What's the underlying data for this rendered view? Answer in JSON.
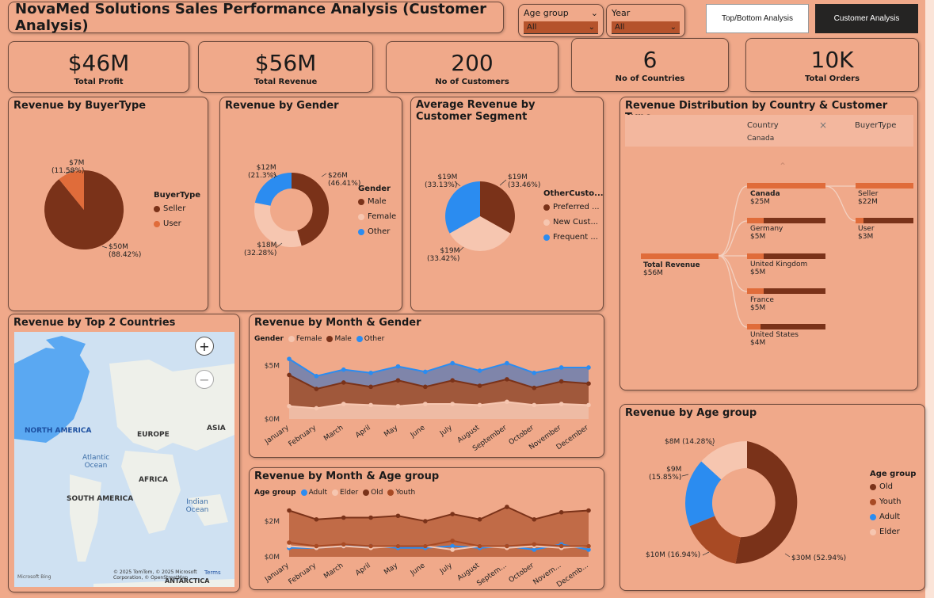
{
  "header": {
    "title": "NovaMed Solutions Sales Performance Analysis (Customer Analysis)"
  },
  "slicers": {
    "age_group": {
      "label": "Age group",
      "value": "All"
    },
    "year": {
      "label": "Year",
      "value": "All"
    }
  },
  "nav": {
    "topbottom": "Top/Bottom Analysis",
    "customer": "Customer Analysis"
  },
  "kpis": [
    {
      "value": "$46M",
      "label": "Total Profit"
    },
    {
      "value": "$56M",
      "label": "Total Revenue"
    },
    {
      "value": "200",
      "label": "No of Customers"
    },
    {
      "value": "6",
      "label": "No of Countries"
    },
    {
      "value": "10K",
      "label": "Total Orders"
    }
  ],
  "colors": {
    "bg": "#f0a98a",
    "seller": "#7a3219",
    "user": "#e06c3a",
    "female": "#f6c6b0",
    "male": "#7a3219",
    "other": "#2b8cf0",
    "adult": "#2b8cf0",
    "youth": "#a84a24",
    "old": "#7a3219",
    "elder": "#f6c6b0"
  },
  "buyer": {
    "title": "Revenue by BuyerType",
    "legend_title": "BuyerType",
    "items": [
      "Seller",
      "User"
    ],
    "label_user": [
      "$7M",
      "(11.58%)"
    ],
    "label_seller": [
      "$50M",
      "(88.42%)"
    ]
  },
  "gender": {
    "title": "Revenue by Gender",
    "legend_title": "Gender",
    "items": [
      "Male",
      "Female",
      "Other"
    ],
    "label_other": [
      "$12M",
      "(21.3%)"
    ],
    "label_male": [
      "$26M",
      "(46.41%)"
    ],
    "label_female": [
      "$18M",
      "(32.28%)"
    ]
  },
  "segment": {
    "title": "Average Revenue by Customer Segment",
    "legend_title": "OtherCusto...",
    "items": [
      "Preferred ...",
      "New Cust...",
      "Frequent ..."
    ],
    "label_a": [
      "$19M",
      "(33.13%)"
    ],
    "label_b": [
      "$19M",
      "(33.46%)"
    ],
    "label_c": [
      "$19M",
      "(33.42%)"
    ]
  },
  "decomp": {
    "title": "Revenue Distribution by Country & Customer Type",
    "col1": "Country",
    "col1_sub": "Canada",
    "col2": "BuyerType",
    "root": {
      "label": "Total Revenue",
      "value": "$56M"
    },
    "countries": [
      {
        "name": "Canada",
        "value": "$25M"
      },
      {
        "name": "Germany",
        "value": "$5M"
      },
      {
        "name": "United Kingdom",
        "value": "$5M"
      },
      {
        "name": "France",
        "value": "$5M"
      },
      {
        "name": "United States",
        "value": "$4M"
      }
    ],
    "buyers": [
      {
        "name": "Seller",
        "value": "$22M"
      },
      {
        "name": "User",
        "value": "$3M"
      }
    ]
  },
  "map": {
    "title": "Revenue by Top 2 Countries",
    "labels": [
      "NORTH AMERICA",
      "EUROPE",
      "ASIA",
      "AFRICA",
      "SOUTH AMERICA",
      "Atlantic Ocean",
      "Indian Ocean",
      "ANTARCTICA"
    ],
    "attribution": "© 2025 TomTom, © 2025 Microsoft Corporation, © OpenStreetMap",
    "terms": "Terms",
    "brand": "Microsoft Bing"
  },
  "month_gender": {
    "title": "Revenue by Month & Gender",
    "legend_title": "Gender",
    "legend": [
      "Female",
      "Male",
      "Other"
    ]
  },
  "month_age": {
    "title": "Revenue by Month & Age group",
    "legend_title": "Age group",
    "legend": [
      "Adult",
      "Elder",
      "Old",
      "Youth"
    ]
  },
  "age": {
    "title": "Revenue by Age group",
    "legend_title": "Age group",
    "items": [
      "Old",
      "Youth",
      "Adult",
      "Elder"
    ],
    "label_elder": "$8M (14.28%)",
    "label_adult": [
      "$9M",
      "(15.85%)"
    ],
    "label_youth": "$10M (16.94%)",
    "label_old": "$30M (52.94%)"
  },
  "chart_data": [
    {
      "type": "pie",
      "title": "Revenue by BuyerType",
      "categories": [
        "Seller",
        "User"
      ],
      "values": [
        50,
        7
      ],
      "percent": [
        88.42,
        11.58
      ]
    },
    {
      "type": "pie",
      "title": "Revenue by Gender",
      "categories": [
        "Male",
        "Female",
        "Other"
      ],
      "values": [
        26,
        18,
        12
      ],
      "percent": [
        46.41,
        32.28,
        21.3
      ]
    },
    {
      "type": "pie",
      "title": "Average Revenue by Customer Segment",
      "categories": [
        "Preferred ...",
        "New Cust...",
        "Frequent ..."
      ],
      "values": [
        19,
        19,
        19
      ],
      "percent": [
        33.46,
        33.42,
        33.13
      ]
    },
    {
      "type": "pie",
      "title": "Revenue by Age group",
      "categories": [
        "Old",
        "Youth",
        "Adult",
        "Elder"
      ],
      "values": [
        30,
        10,
        9,
        8
      ],
      "percent": [
        52.94,
        16.94,
        15.85,
        14.28
      ]
    },
    {
      "type": "area",
      "title": "Revenue by Month & Gender",
      "categories": [
        "January",
        "February",
        "March",
        "April",
        "May",
        "June",
        "July",
        "August",
        "September",
        "October",
        "November",
        "December"
      ],
      "yticks": [
        "$5M",
        "$0M"
      ],
      "ylim": [
        0,
        6.2
      ],
      "series": [
        {
          "name": "Female",
          "values": [
            1.2,
            1.0,
            1.4,
            1.3,
            1.2,
            1.4,
            1.4,
            1.3,
            1.6,
            1.3,
            1.4,
            1.3
          ]
        },
        {
          "name": "Male",
          "values": [
            4.1,
            2.8,
            3.4,
            3.0,
            3.6,
            3.0,
            3.6,
            3.1,
            3.7,
            2.9,
            3.5,
            3.3
          ]
        },
        {
          "name": "Other",
          "values": [
            5.6,
            4.0,
            4.6,
            4.3,
            4.9,
            4.4,
            5.2,
            4.5,
            5.2,
            4.3,
            4.8,
            4.8
          ]
        }
      ]
    },
    {
      "type": "area",
      "title": "Revenue by Month & Age group",
      "categories": [
        "January",
        "February",
        "March",
        "April",
        "May",
        "June",
        "July",
        "August",
        "Septem...",
        "October",
        "Novem...",
        "Decemb..."
      ],
      "yticks": [
        "$2M",
        "$0M"
      ],
      "ylim": [
        0,
        3.2
      ],
      "series": [
        {
          "name": "Adult",
          "values": [
            0.5,
            0.5,
            0.6,
            0.6,
            0.5,
            0.5,
            0.6,
            0.5,
            0.6,
            0.4,
            0.7,
            0.4
          ]
        },
        {
          "name": "Elder",
          "values": [
            0.6,
            0.5,
            0.6,
            0.5,
            0.6,
            0.6,
            0.4,
            0.6,
            0.5,
            0.6,
            0.5,
            0.6
          ]
        },
        {
          "name": "Old",
          "values": [
            2.6,
            2.1,
            2.2,
            2.2,
            2.3,
            2.0,
            2.4,
            2.1,
            2.8,
            2.1,
            2.5,
            2.6
          ]
        },
        {
          "name": "Youth",
          "values": [
            0.8,
            0.6,
            0.7,
            0.6,
            0.6,
            0.6,
            0.9,
            0.6,
            0.6,
            0.7,
            0.6,
            0.6
          ]
        }
      ]
    }
  ]
}
